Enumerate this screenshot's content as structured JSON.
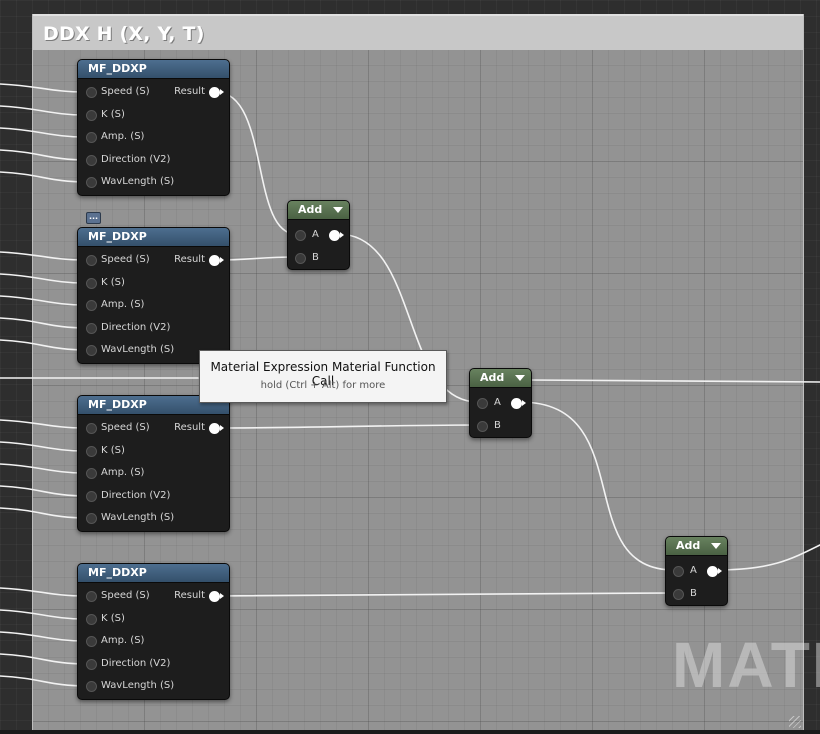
{
  "comment": {
    "title": "DDX H (X, Y, T)"
  },
  "watermark": "MATE",
  "mf_nodes": [
    {
      "title": "MF_DDXP",
      "inputs": [
        "Speed (S)",
        "K (S)",
        "Amp. (S)",
        "Direction (V2)",
        "WavLength (S)"
      ],
      "output": "Result"
    },
    {
      "title": "MF_DDXP",
      "inputs": [
        "Speed (S)",
        "K (S)",
        "Amp. (S)",
        "Direction (V2)",
        "WavLength (S)"
      ],
      "output": "Result"
    },
    {
      "title": "MF_DDXP",
      "inputs": [
        "Speed (S)",
        "K (S)",
        "Amp. (S)",
        "Direction (V2)",
        "WavLength (S)"
      ],
      "output": "Result"
    },
    {
      "title": "MF_DDXP",
      "inputs": [
        "Speed (S)",
        "K (S)",
        "Amp. (S)",
        "Direction (V2)",
        "WavLength (S)"
      ],
      "output": "Result"
    }
  ],
  "add_nodes": [
    {
      "title": "Add",
      "inputs": [
        "A",
        "B"
      ]
    },
    {
      "title": "Add",
      "inputs": [
        "A",
        "B"
      ]
    },
    {
      "title": "Add",
      "inputs": [
        "A",
        "B"
      ]
    }
  ],
  "badge": "...",
  "tooltip": {
    "title": "Material Expression Material Function Call",
    "subtitle": "hold (Ctrl + Alt) for more"
  },
  "colors": {
    "mf_header": "#3f5d7c",
    "add_header": "#58724f",
    "wire": "#ffffff"
  }
}
